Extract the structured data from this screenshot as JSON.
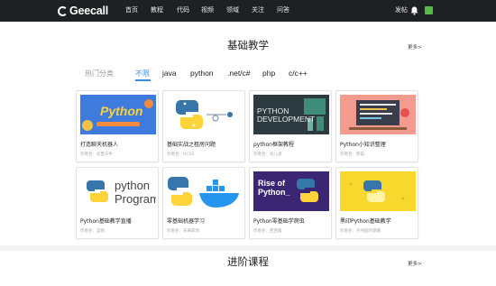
{
  "brand": "Geecall",
  "nav": {
    "items": [
      "首页",
      "教程",
      "代码",
      "视频",
      "领域",
      "关注",
      "问答"
    ],
    "post": "发帖"
  },
  "section": {
    "title": "基础教学",
    "more": "更多>"
  },
  "tabs": {
    "category": "热门分类",
    "items": [
      "不限",
      "java",
      "python",
      ".net/c#",
      "php",
      "c/c++"
    ]
  },
  "cards": [
    {
      "title": "打造聊天机器人",
      "author": "作者名：初夏天牛",
      "thumb_text": "Python"
    },
    {
      "title": "基础实战之租房问题",
      "author": "作者名：HCSS"
    },
    {
      "title": "python框架教程",
      "author": "作者名：谷儿遥",
      "thumb_text": "PYTHON DEVELOPMENT"
    },
    {
      "title": "Python小知识整理",
      "author": "作者名：熊猫"
    },
    {
      "title": "Python基础教学直播",
      "author": "作者名：蓝帆",
      "thumb_text": "python Programming"
    },
    {
      "title": "零基础机器学习",
      "author": "作者名：未来职场"
    },
    {
      "title": "Python零基础学爬虫",
      "author": "作者名：西西酱",
      "thumb_text": "Rise of Python_"
    },
    {
      "title": "黑印Python基础教学",
      "author": "作者名：齐书园的草帽"
    }
  ],
  "bottom_section": {
    "title": "进阶课程",
    "more": "更多>"
  },
  "colors": {
    "nav_bg": "#1f2024",
    "accent": "#3a8ee6",
    "python_blue": "#3776ab",
    "python_yellow": "#ffd43b"
  }
}
